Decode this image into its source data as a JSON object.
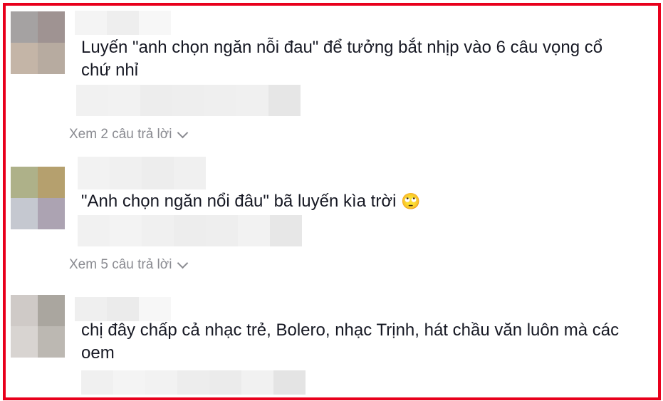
{
  "comments": [
    {
      "text": "Luyến \"anh chọn ngăn nỗi đau\" để tưởng bắt nhịp vào 6 câu vọng cổ chứ nhỉ",
      "replies_label": "Xem 2 câu trả lời",
      "avatar_colors": [
        "#a5a2a2",
        "#9f9392",
        "#c4b5a7",
        "#b7aba0"
      ],
      "name_colors": [
        "#f4f4f4",
        "#eeeeee",
        "#f7f7f7"
      ],
      "meta_colors": [
        "#f1f1f1",
        "#f2f2f2",
        "#ededed",
        "#eeeeee",
        "#efefef",
        "#f0f0f0",
        "#e6e6e6"
      ]
    },
    {
      "text": "\"Anh chọn ngăn nổi đâu\" bã luyến kìa trời",
      "emoji": "🙄",
      "replies_label": "Xem 5 câu trả lời",
      "avatar_colors": [
        "#aeb189",
        "#b5a06e",
        "#c5c8d0",
        "#aca3b2"
      ],
      "name_colors": [
        "#f2f2f2",
        "#f0f0f0",
        "#ededed",
        "#f0f0f0"
      ],
      "meta_colors": [
        "#f1f1f1",
        "#f3f3f3",
        "#f0f0f0",
        "#ededed",
        "#eeeeee",
        "#f2f2f2",
        "#e7e7e7"
      ]
    },
    {
      "text": "chị đây chấp cả nhạc trẻ, Bolero, nhạc Trịnh, hát chầu văn luôn mà các oem",
      "avatar_colors": [
        "#cfcac7",
        "#aaa69f",
        "#d8d4d1",
        "#bcb8b2"
      ],
      "name_colors": [
        "#efefef",
        "#ebebeb",
        "#f7f7f7"
      ],
      "meta_colors": [
        "#f0f0f0",
        "#f4f4f4",
        "#f2f2f2",
        "#ededed",
        "#ebebeb",
        "#f1f1f1",
        "#e4e4e4"
      ]
    }
  ]
}
